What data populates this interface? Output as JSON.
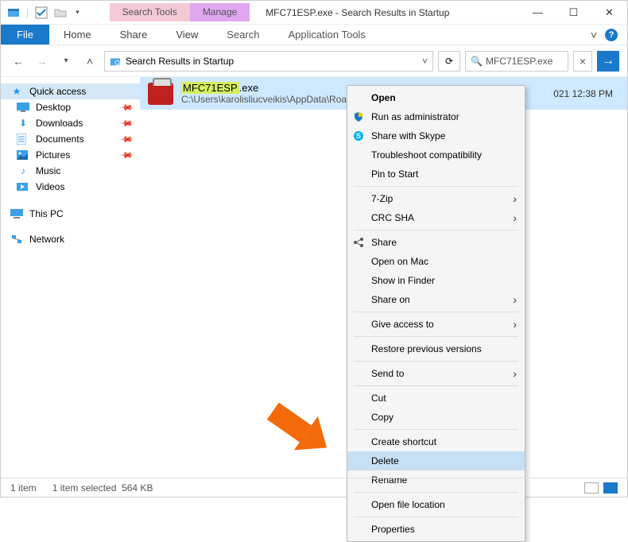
{
  "titlebar": {
    "title": "MFC71ESP.exe - Search Results in Startup",
    "tooltab_search": "Search Tools",
    "tooltab_search_sub": "Search",
    "tooltab_manage": "Manage",
    "tooltab_manage_sub": "Application Tools"
  },
  "wincontrols": {
    "min": "—",
    "max": "☐",
    "close": "✕"
  },
  "ribbon": {
    "file": "File",
    "home": "Home",
    "share": "Share",
    "view": "View",
    "search": "Search",
    "apptools": "Application Tools",
    "expand": "˅"
  },
  "address": {
    "back": "←",
    "forward": "→",
    "up": "˄",
    "path": "Search Results in Startup",
    "refresh": "⟳",
    "search_icon": "🔍",
    "search_text": "MFC71ESP.exe",
    "clear": "×",
    "go": "→"
  },
  "sidebar": {
    "quick": "Quick access",
    "items": [
      {
        "label": "Desktop",
        "pinned": true,
        "color": "#3aa0e8"
      },
      {
        "label": "Downloads",
        "pinned": true,
        "color": "#3aa0e8"
      },
      {
        "label": "Documents",
        "pinned": true,
        "color": "#3aa0e8"
      },
      {
        "label": "Pictures",
        "pinned": true,
        "color": "#3aa0e8"
      },
      {
        "label": "Music",
        "pinned": false,
        "color": "#3aa0e8"
      },
      {
        "label": "Videos",
        "pinned": false,
        "color": "#3aa0e8"
      }
    ],
    "thispc": "This PC",
    "network": "Network"
  },
  "result": {
    "name_hl": "MFC71ESP",
    "name_ext": ".exe",
    "path": "C:\\Users\\karolisliucveikis\\AppData\\Roam",
    "date": "021 12:38 PM"
  },
  "context_menu": {
    "open": "Open",
    "run_admin": "Run as administrator",
    "share_skype": "Share with Skype",
    "troubleshoot": "Troubleshoot compatibility",
    "pin_start": "Pin to Start",
    "sevenzip": "7-Zip",
    "crc": "CRC SHA",
    "share": "Share",
    "open_mac": "Open on Mac",
    "show_finder": "Show in Finder",
    "share_on": "Share on",
    "give_access": "Give access to",
    "restore": "Restore previous versions",
    "send_to": "Send to",
    "cut": "Cut",
    "copy": "Copy",
    "shortcut": "Create shortcut",
    "delete": "Delete",
    "rename": "Rename",
    "open_loc": "Open file location",
    "properties": "Properties"
  },
  "statusbar": {
    "items": "1 item",
    "selected": "1 item selected",
    "size": "564 KB"
  }
}
